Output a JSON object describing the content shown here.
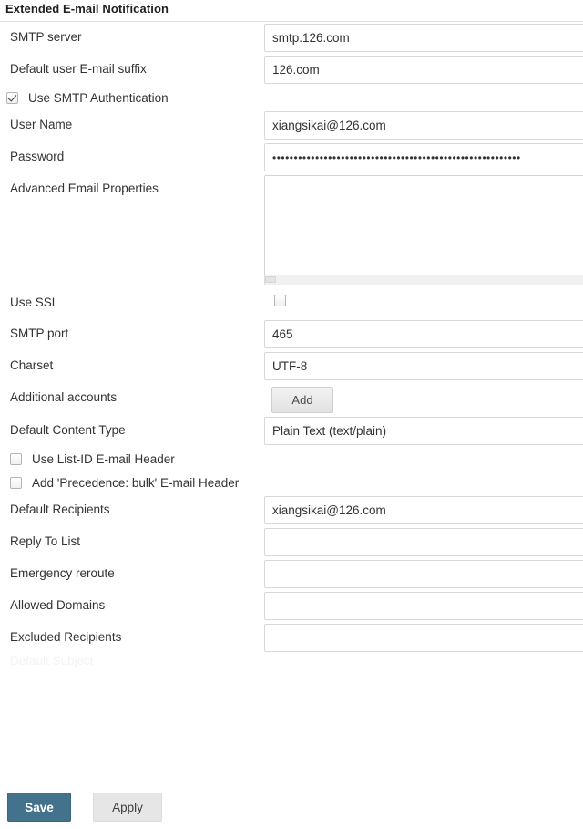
{
  "section": {
    "title": "Extended E-mail Notification"
  },
  "fields": {
    "smtp_server": {
      "label": "SMTP server",
      "value": "smtp.126.com"
    },
    "email_suffix": {
      "label": "Default user E-mail suffix",
      "value": "126.com"
    },
    "use_smtp_auth": {
      "label": "Use SMTP Authentication",
      "checked": true
    },
    "user_name": {
      "label": "User Name",
      "value": "xiangsikai@126.com"
    },
    "password": {
      "label": "Password",
      "value": "••••••••••••••••••••••••••••••••••••••••••••••••••••••••••"
    },
    "advanced_props": {
      "label": "Advanced Email Properties",
      "value": ""
    },
    "use_ssl": {
      "label": "Use SSL",
      "checked": false
    },
    "smtp_port": {
      "label": "SMTP port",
      "value": "465"
    },
    "charset": {
      "label": "Charset",
      "value": "UTF-8"
    },
    "additional_accounts": {
      "label": "Additional accounts",
      "button_label": "Add"
    },
    "default_content_type": {
      "label": "Default Content Type",
      "value": "Plain Text (text/plain)"
    },
    "use_list_id_header": {
      "label": "Use List-ID E-mail Header",
      "checked": false
    },
    "add_precedence_bulk_header": {
      "label": "Add 'Precedence: bulk' E-mail Header",
      "checked": false
    },
    "default_recipients": {
      "label": "Default Recipients",
      "value": "xiangsikai@126.com"
    },
    "reply_to_list": {
      "label": "Reply To List",
      "value": ""
    },
    "emergency_reroute": {
      "label": "Emergency reroute",
      "value": ""
    },
    "allowed_domains": {
      "label": "Allowed Domains",
      "value": ""
    },
    "excluded_recipients": {
      "label": "Excluded Recipients",
      "value": ""
    },
    "cut_off_row": {
      "label": "Default Subject"
    }
  },
  "footer": {
    "save_label": "Save",
    "apply_label": "Apply"
  },
  "colors": {
    "save_button": "#43728c",
    "apply_button": "#e6e6e6",
    "input_border": "#d8d8d8",
    "text": "#333333"
  }
}
